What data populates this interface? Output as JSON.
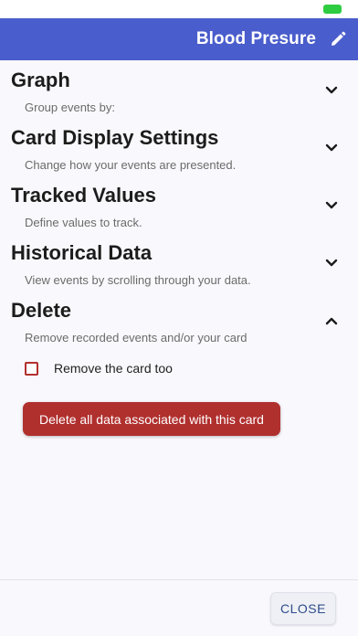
{
  "status_bar": {
    "battery_color": "#2ecc40"
  },
  "header": {
    "title": "Blood Presure",
    "edit_icon": "pencil-icon",
    "background": "#4a5dcc"
  },
  "sections": [
    {
      "title": "Graph",
      "subtitle": "Group events by:",
      "expanded": false
    },
    {
      "title": "Card Display Settings",
      "subtitle": "Change how your events are presented.",
      "expanded": false
    },
    {
      "title": "Tracked Values",
      "subtitle": "Define values to track.",
      "expanded": false
    },
    {
      "title": "Historical Data",
      "subtitle": "View events by scrolling through your data.",
      "expanded": false
    },
    {
      "title": "Delete",
      "subtitle": "Remove recorded events and/or your card",
      "expanded": true
    }
  ],
  "delete": {
    "checkbox_label": "Remove the card too",
    "checkbox_checked": false,
    "button_label": "Delete all data associated with this card",
    "button_color": "#b0302e"
  },
  "footer": {
    "close_label": "CLOSE"
  }
}
